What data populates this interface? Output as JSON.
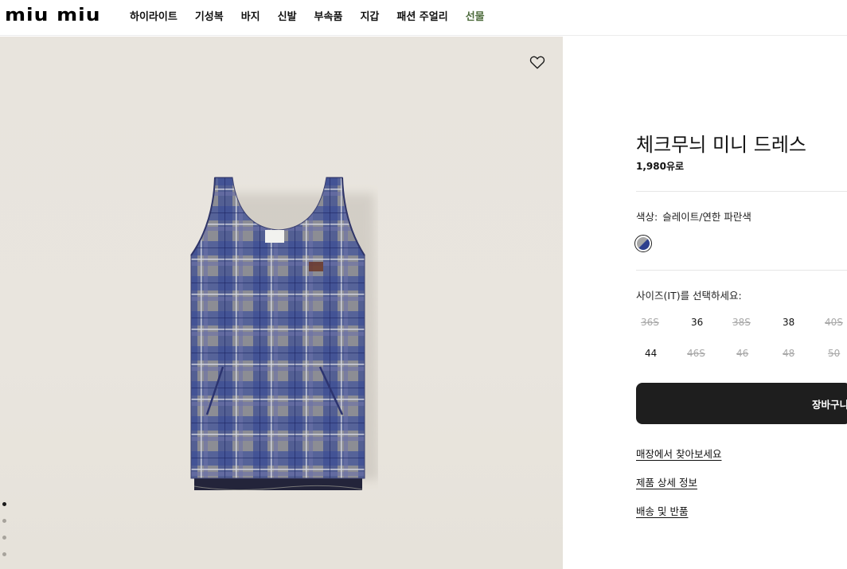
{
  "brand": {
    "logo_text": "miu miu"
  },
  "nav": {
    "items": [
      {
        "label": "하이라이트"
      },
      {
        "label": "기성복"
      },
      {
        "label": "바지"
      },
      {
        "label": "신발"
      },
      {
        "label": "부속품"
      },
      {
        "label": "지갑"
      },
      {
        "label": "패션 주얼리"
      },
      {
        "label": "선물"
      }
    ],
    "accent_color": "#4d6b3c"
  },
  "gallery": {
    "wishlist_icon": "heart-outline-icon",
    "dots": 4,
    "active_dot": 1,
    "background_color": "#e8e4dd"
  },
  "product": {
    "title": "체크무늬 미니 드레스",
    "price": "1,980유로",
    "color_label": "색상:",
    "color_value": "슬레이트/연한 파란색",
    "swatch_colors": [
      "#a8a8a8",
      "#2e3f8e"
    ],
    "size_label": "사이즈(IT)를 선택하세요:",
    "sizes": [
      {
        "label": "36S",
        "available": false
      },
      {
        "label": "36",
        "available": true
      },
      {
        "label": "38S",
        "available": false
      },
      {
        "label": "38",
        "available": true
      },
      {
        "label": "40S",
        "available": false
      },
      {
        "label": "44",
        "available": true
      },
      {
        "label": "46S",
        "available": false
      },
      {
        "label": "46",
        "available": false
      },
      {
        "label": "48",
        "available": false
      },
      {
        "label": "50",
        "available": false
      }
    ],
    "add_to_cart": "장바구니",
    "links": {
      "find_in_store": "매장에서 찾아보세요",
      "product_details": "제품 상세 정보",
      "shipping_returns": "배송 및 반품"
    }
  }
}
